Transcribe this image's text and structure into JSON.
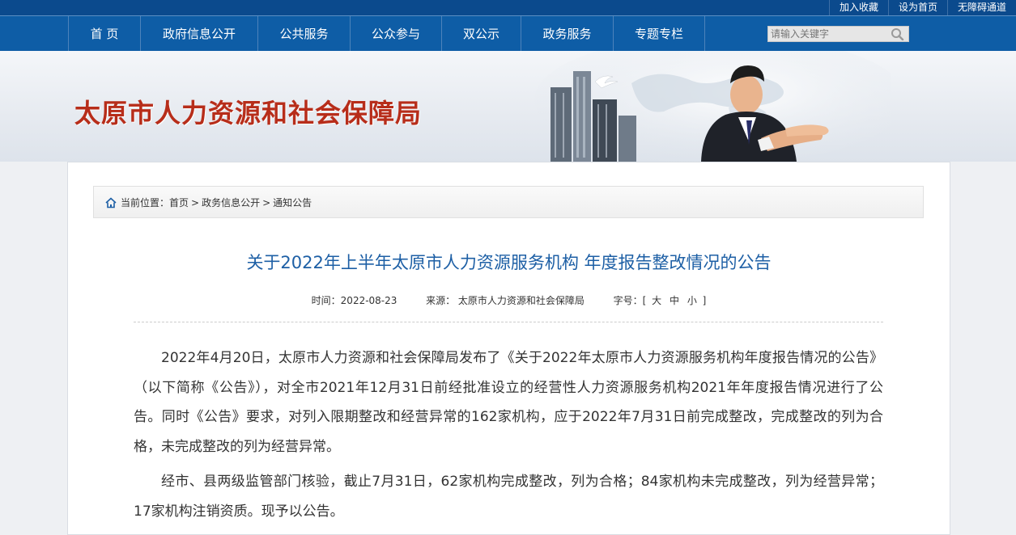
{
  "topbar": {
    "links": [
      "加入收藏",
      "设为首页",
      "无障碍通道"
    ]
  },
  "nav": {
    "items": [
      "首 页",
      "政府信息公开",
      "公共服务",
      "公众参与",
      "双公示",
      "政务服务",
      "专题专栏"
    ],
    "search_placeholder": "请输入关键字"
  },
  "banner": {
    "site_title": "太原市人力资源和社会保障局"
  },
  "breadcrumb": {
    "prefix": "当前位置：",
    "items": [
      "首页",
      "政务信息公开",
      "通知公告"
    ],
    "separator": ">"
  },
  "article": {
    "title": "关于2022年上半年太原市人力资源服务机构 年度报告整改情况的公告",
    "time_label": "时间：",
    "time_value": "2022-08-23",
    "source_label": "来源：",
    "source_value": "太原市人力资源和社会保障局",
    "fontsize_label": "字号：",
    "fontsize_open": "[",
    "fontsize_options": [
      "大",
      "中",
      "小"
    ],
    "fontsize_close": "]",
    "paragraphs": [
      "2022年4月20日，太原市人力资源和社会保障局发布了《关于2022年太原市人力资源服务机构年度报告情况的公告》（以下简称《公告》），对全市2021年12月31日前经批准设立的经营性人力资源服务机构2021年年度报告情况进行了公告。同时《公告》要求，对列入限期整改和经营异常的162家机构，应于2022年7月31日前完成整改，完成整改的列为合格，未完成整改的列为经营异常。",
      "经市、县两级监管部门核验，截止7月31日，62家机构完成整改，列为合格；84家机构未完成整改，列为经营异常；17家机构注销资质。现予以公告。"
    ]
  },
  "colors": {
    "topbar": "#0b4a8d",
    "nav": "#0e5da6",
    "site_title": "#b72d1a",
    "article_title": "#1d5fa5"
  }
}
